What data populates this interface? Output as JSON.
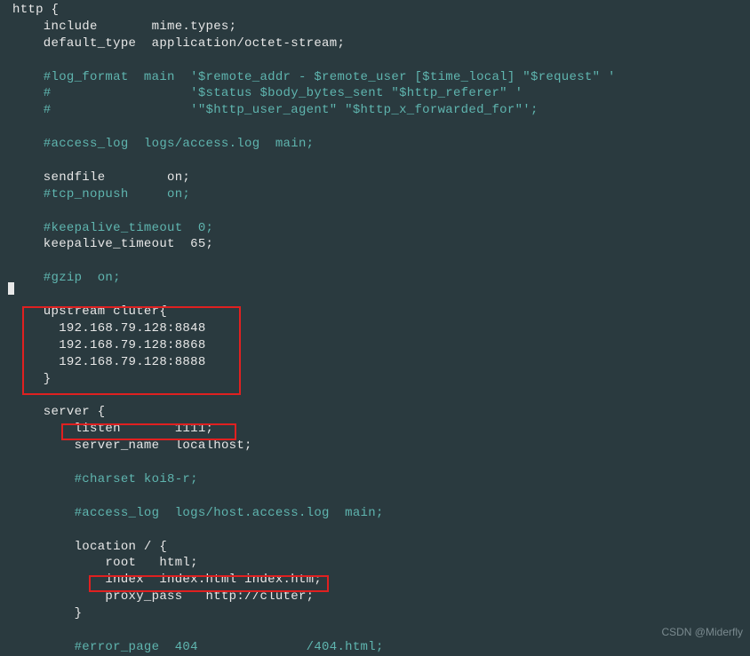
{
  "code": {
    "l1": "http {",
    "l2_a": "    include       ",
    "l2_b": "mime.types;",
    "l3_a": "    default_type  ",
    "l3_b": "application/octet-stream;",
    "l4": "",
    "l5": "    #log_format  main  '$remote_addr - $remote_user [$time_local] \"$request\" '",
    "l6": "    #                  '$status $body_bytes_sent \"$http_referer\" '",
    "l7": "    #                  '\"$http_user_agent\" \"$http_x_forwarded_for\"';",
    "l8": "",
    "l9": "    #access_log  logs/access.log  main;",
    "l10": "",
    "l11_a": "    sendfile        ",
    "l11_b": "on;",
    "l12": "    #tcp_nopush     on;",
    "l13": "",
    "l14": "    #keepalive_timeout  0;",
    "l15_a": "    keepalive_timeout  ",
    "l15_b": "65;",
    "l16": "",
    "l17": "    #gzip  on;",
    "l18": "",
    "l19": "    upstream cluter{",
    "l20": "      192.168.79.128:8848",
    "l21": "      192.168.79.128:8868",
    "l22": "      192.168.79.128:8888",
    "l23": "    }",
    "l24": "",
    "l25": "    server {",
    "l26_a": "        listen       ",
    "l26_b": "1111;",
    "l27_a": "        server_name  ",
    "l27_b": "localhost;",
    "l28": "",
    "l29": "        #charset koi8-r;",
    "l30": "",
    "l31": "        #access_log  logs/host.access.log  main;",
    "l32": "",
    "l33": "        location / {",
    "l34_a": "            root   ",
    "l34_b": "html;",
    "l35_a": "            index  ",
    "l35_b": "index.html index.htm;",
    "l36_a": "            proxy_pass   ",
    "l36_b": "http://cluter;",
    "l37": "        }",
    "l38": "",
    "l39": "        #error_page  404              /404.html;"
  },
  "watermark": "CSDN @Miderfly"
}
